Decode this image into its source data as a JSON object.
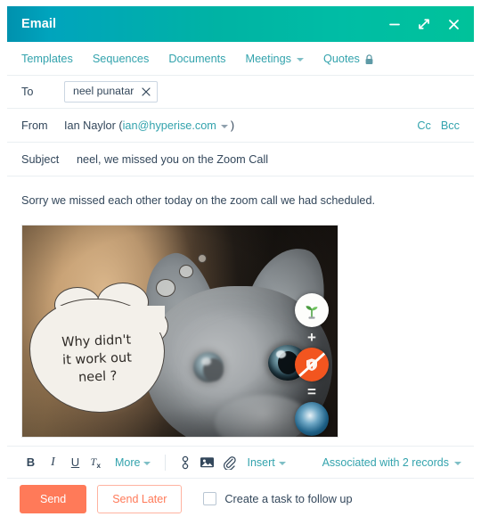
{
  "window": {
    "title": "Email",
    "controls": [
      {
        "name": "minimize-button",
        "icon": "minimize-icon"
      },
      {
        "name": "expand-button",
        "icon": "expand-diagonal-icon"
      },
      {
        "name": "close-button",
        "icon": "close-icon"
      }
    ]
  },
  "tabs": [
    {
      "label": "Templates",
      "caret": false,
      "lock": false
    },
    {
      "label": "Sequences",
      "caret": false,
      "lock": false
    },
    {
      "label": "Documents",
      "caret": false,
      "lock": false
    },
    {
      "label": "Meetings",
      "caret": true,
      "lock": false
    },
    {
      "label": "Quotes",
      "caret": false,
      "lock": true
    }
  ],
  "compose": {
    "to_label": "To",
    "recipient_chip": "neel punatar",
    "from_label": "From",
    "from_name": "Ian Naylor (",
    "from_email": "ian@hyperise.com",
    "from_close": ")",
    "cc_label": "Cc",
    "bcc_label": "Bcc",
    "subject_label": "Subject",
    "subject_value": "neel, we missed you on the Zoom Call"
  },
  "body": {
    "paragraph": "Sorry we missed each other today on the zoom call we had scheduled.",
    "image": {
      "alt": "kitten-photo-with-thought-bubble",
      "bubble_line1": "Why didn't",
      "bubble_line2": "it work out",
      "bubble_line3": "neel ?",
      "overlay": {
        "seedling_icon": "seedling-icon",
        "plus": "+",
        "no_entry_icon": "orange-slash-icon",
        "equals": "=",
        "result_icon": "blue-circle-icon"
      }
    }
  },
  "toolbar": {
    "bold": "B",
    "italic": "I",
    "underline": "U",
    "clear_format": "Tx",
    "more_label": "More",
    "personalize_icon": "personalize-token-icon",
    "image_icon": "insert-image-icon",
    "attach_icon": "paperclip-icon",
    "insert_label": "Insert",
    "associated_label": "Associated with 2 records"
  },
  "footer": {
    "send_label": "Send",
    "send_later_label": "Send Later",
    "task_label": "Create a task to follow up"
  },
  "colors": {
    "header_start": "#0091ae",
    "header_end": "#00c29a",
    "link": "#33a3ad",
    "text": "#33475b",
    "accent": "#ff7a59"
  }
}
